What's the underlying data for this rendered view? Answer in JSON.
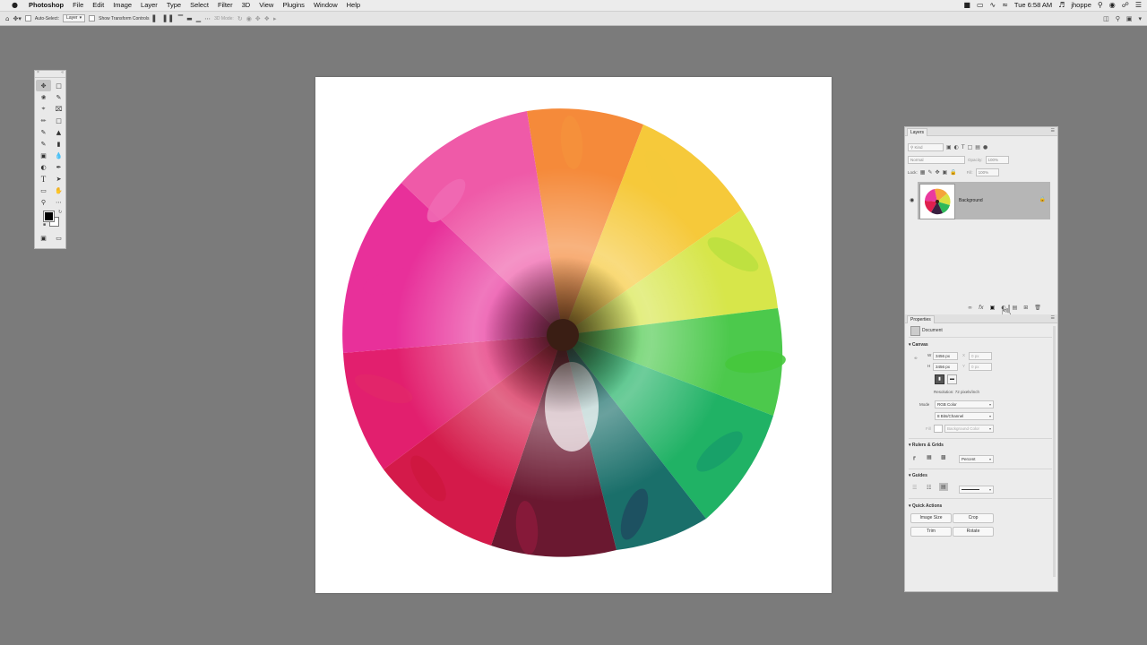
{
  "menubar": {
    "apple": "",
    "app_name": "Photoshop",
    "items": [
      "File",
      "Edit",
      "Image",
      "Layer",
      "Type",
      "Select",
      "Filter",
      "3D",
      "View",
      "Plugins",
      "Window",
      "Help"
    ],
    "clock": "Tue 6:58 AM",
    "user": "jhoppe"
  },
  "options_bar": {
    "auto_select_label": "Auto-Select:",
    "auto_select_value": "Layer",
    "transform_controls_label": "Show Transform Controls",
    "mode_3d_label": "3D Mode:"
  },
  "layers_panel": {
    "tab": "Layers",
    "filter_kind": "Kind",
    "blend_mode": "Normal",
    "opacity_label": "Opacity:",
    "opacity_value": "100%",
    "lock_label": "Lock:",
    "fill_label": "Fill:",
    "fill_value": "100%",
    "layer_name": "Background"
  },
  "properties_panel": {
    "tab": "Properties",
    "type_label": "Document",
    "canvas": {
      "title": "Canvas",
      "w_label": "W",
      "w_value": "3456 px",
      "h_label": "H",
      "h_value": "3456 px",
      "x_label": "X",
      "x_value": "0 px",
      "y_label": "Y",
      "y_value": "0 px",
      "resolution": "Resolution: 72 pixels/inch",
      "mode_label": "Mode",
      "mode_value": "RGB Color",
      "depth_value": "8 Bits/Channel",
      "fill_label": "Fill",
      "fill_value": "Background Color"
    },
    "rulers": {
      "title": "Rulers & Grids",
      "unit": "Percent"
    },
    "guides": {
      "title": "Guides"
    },
    "quick_actions": {
      "title": "Quick Actions",
      "image_size": "Image Size",
      "crop": "Crop",
      "trim": "Trim",
      "rotate": "Rotate"
    }
  },
  "colors": {
    "foreground": "#000000",
    "background": "#ffffff"
  }
}
